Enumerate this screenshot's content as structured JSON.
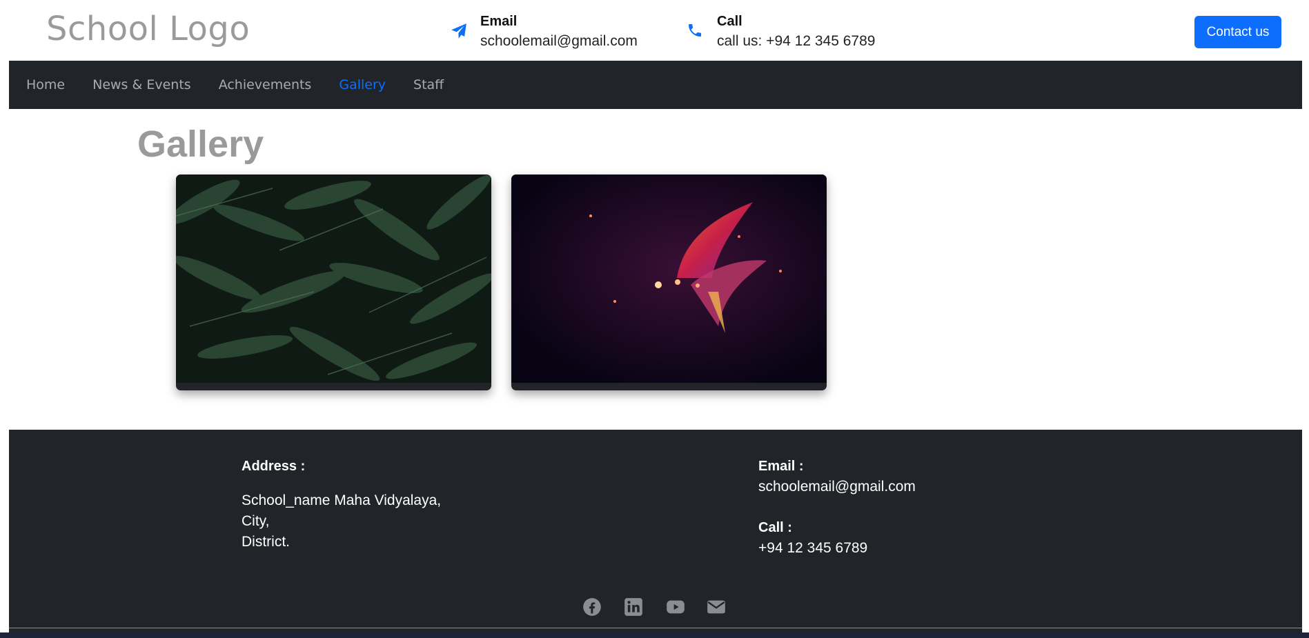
{
  "header": {
    "logo": "School Logo",
    "email_title": "Email",
    "email_value": "schoolemail@gmail.com",
    "call_title": "Call",
    "call_value": "call us: +94 12 345 6789",
    "contact_button": "Contact us",
    "email_icon": "paper-plane-icon",
    "call_icon": "phone-icon"
  },
  "nav": {
    "items": [
      {
        "label": "Home",
        "active": false
      },
      {
        "label": "News & Events",
        "active": false
      },
      {
        "label": "Achievements",
        "active": false
      },
      {
        "label": "Gallery",
        "active": true
      },
      {
        "label": "Staff",
        "active": false
      }
    ]
  },
  "gallery": {
    "title": "Gallery",
    "images": [
      {
        "subject": "fern leaves"
      },
      {
        "subject": "abstract colorful light burst"
      }
    ]
  },
  "footer": {
    "address_label": "Address :",
    "address_line1": "School_name Maha Vidyalaya,",
    "address_line2": "City,",
    "address_line3": "District.",
    "email_label": "Email :",
    "email_value": "schoolemail@gmail.com",
    "call_label": "Call :",
    "call_value": "+94 12 345 6789",
    "social_icons": [
      "facebook-icon",
      "linkedin-icon",
      "youtube-icon",
      "envelope-icon"
    ]
  },
  "colors": {
    "accent": "#0d6efd",
    "dark": "#212529",
    "logo_gray": "#9a9a9a"
  }
}
